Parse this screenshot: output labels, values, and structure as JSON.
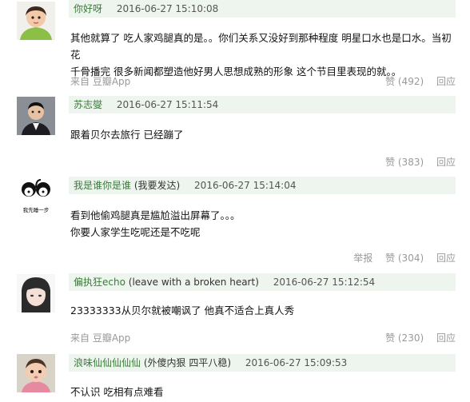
{
  "comments": [
    {
      "username": "你好呀",
      "note": "",
      "time": "2016-06-27 15:10:08",
      "text": [
        "其他就算了 吃人家鸡腿真的是。。你们关系又没好到那种程度 明星口水也是口水。当初花",
        "千骨播完 很多新闻都塑造他好男人思想成熟的形象 这个节目里表现的就。。"
      ],
      "source": "来自 豆瓣App",
      "report": "",
      "like": "赞 (492)",
      "reply": "回应"
    },
    {
      "username": "苏志燮",
      "note": "",
      "time": "2016-06-27 15:11:54",
      "text": [
        "跟着贝尔去旅行 已经蹦了"
      ],
      "source": "",
      "report": "",
      "like": "赞 (383)",
      "reply": "回应"
    },
    {
      "username": "我是谁你是谁",
      "note": "(我要发达)",
      "time": "2016-06-27 15:14:04",
      "text": [
        "看到他偷鸡腿真是尴尬溢出屏幕了。。。",
        "你要人家学生吃呢还是不吃呢"
      ],
      "source": "",
      "report": "举报",
      "like": "赞 (304)",
      "reply": "回应"
    },
    {
      "username": "偏执狂echo",
      "note": "(leave with a broken heart)",
      "time": "2016-06-27 15:12:54",
      "text": [
        "23333333从贝尔就被嘲讽了 他真不适合上真人秀"
      ],
      "source": "来自 豆瓣App",
      "report": "",
      "like": "赞 (230)",
      "reply": "回应"
    },
    {
      "username": "浪味仙仙仙仙仙",
      "note": "(外傻内狠 四平八稳)",
      "time": "2016-06-27 15:09:53",
      "text": [
        "不认识 吃相有点难看"
      ],
      "source": "",
      "report": "",
      "like": "",
      "reply": ""
    }
  ],
  "avatar3_caption": "我先睡一步",
  "colors": {
    "header_bg": "#eef4ee",
    "username": "#3a7a3a",
    "meta": "#999999"
  }
}
